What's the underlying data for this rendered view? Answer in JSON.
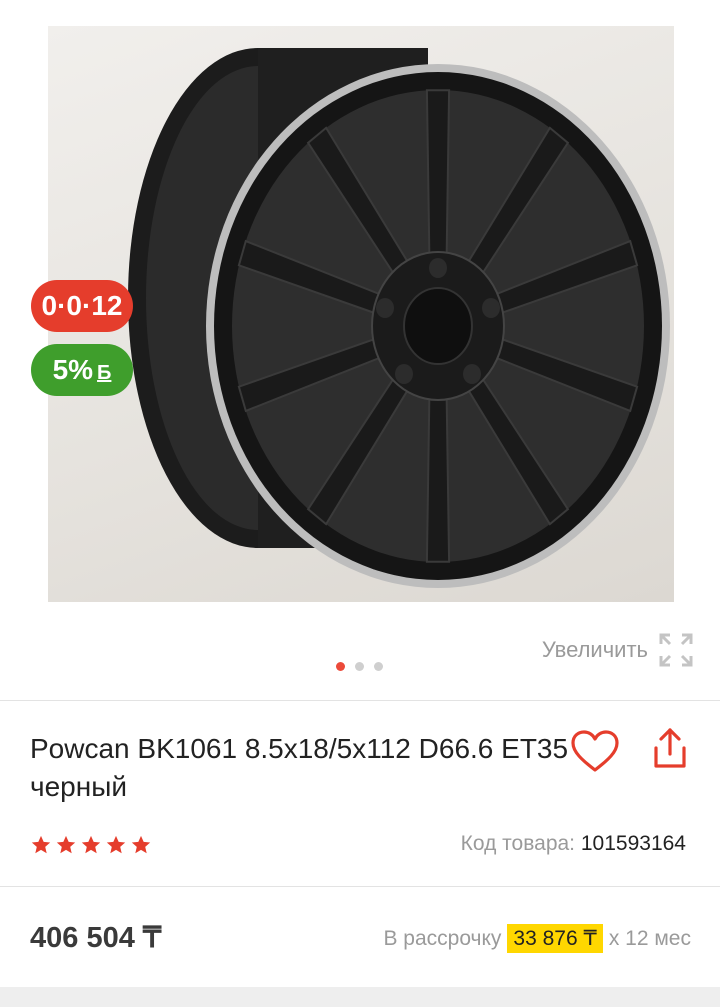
{
  "gallery": {
    "badges": {
      "installment": "0·0·12",
      "bonus_percent": "5%",
      "bonus_symbol": "Б"
    },
    "zoom_label": "Увеличить",
    "dots": {
      "count": 3,
      "active_index": 0
    }
  },
  "product": {
    "title": "Powcan BK1061 8.5x18/5x112 D66.6 ET35 черный",
    "rating": 5,
    "code_label": "Код товара:",
    "code_value": "101593164"
  },
  "pricing": {
    "price": "406 504 ₸",
    "installment_label": "В рассрочку",
    "installment_amount": "33 876 ₸",
    "installment_term": "x 12 мес"
  },
  "colors": {
    "accent_red": "#e53d2c",
    "bonus_green": "#3f9e2c",
    "highlight_yellow": "#ffd700"
  }
}
